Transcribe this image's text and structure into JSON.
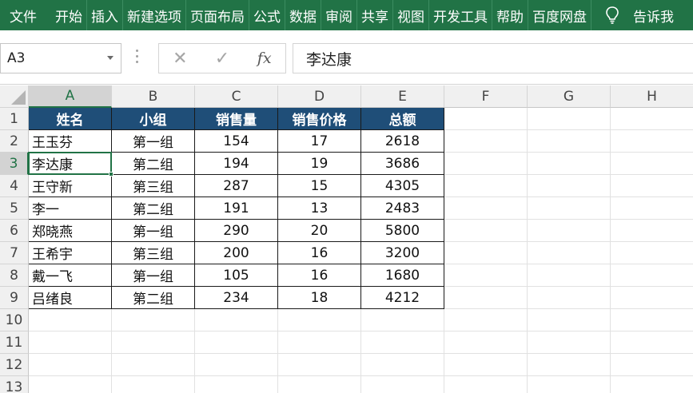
{
  "ribbon": {
    "tabs": [
      "文件",
      "开始",
      "插入",
      "新建选项",
      "页面布局",
      "公式",
      "数据",
      "审阅",
      "共享",
      "视图",
      "开发工具",
      "帮助",
      "百度网盘"
    ],
    "tell_me": "告诉我"
  },
  "formula_bar": {
    "name_box": "A3",
    "content": "李达康",
    "cancel_glyph": "✕",
    "enter_glyph": "✓",
    "fx_label": "fx"
  },
  "sheet": {
    "columns": [
      "A",
      "B",
      "C",
      "D",
      "E",
      "F",
      "G",
      "H"
    ],
    "rows": [
      "1",
      "2",
      "3",
      "4",
      "5",
      "6",
      "7",
      "8",
      "9",
      "10",
      "11",
      "12",
      "13"
    ],
    "selected_cell": "A3",
    "header_fill": "#1f4e78",
    "accent": "#217346",
    "table_headers": [
      "姓名",
      "小组",
      "销售量",
      "销售价格",
      "总额"
    ],
    "table_rows": [
      [
        "王玉芬",
        "第一组",
        "154",
        "17",
        "2618"
      ],
      [
        "李达康",
        "第二组",
        "194",
        "19",
        "3686"
      ],
      [
        "王守新",
        "第三组",
        "287",
        "15",
        "4305"
      ],
      [
        "李一",
        "第二组",
        "191",
        "13",
        "2483"
      ],
      [
        "郑晓燕",
        "第一组",
        "290",
        "20",
        "5800"
      ],
      [
        "王希宇",
        "第三组",
        "200",
        "16",
        "3200"
      ],
      [
        "戴一飞",
        "第一组",
        "105",
        "16",
        "1680"
      ],
      [
        "吕绪良",
        "第二组",
        "234",
        "18",
        "4212"
      ]
    ]
  }
}
